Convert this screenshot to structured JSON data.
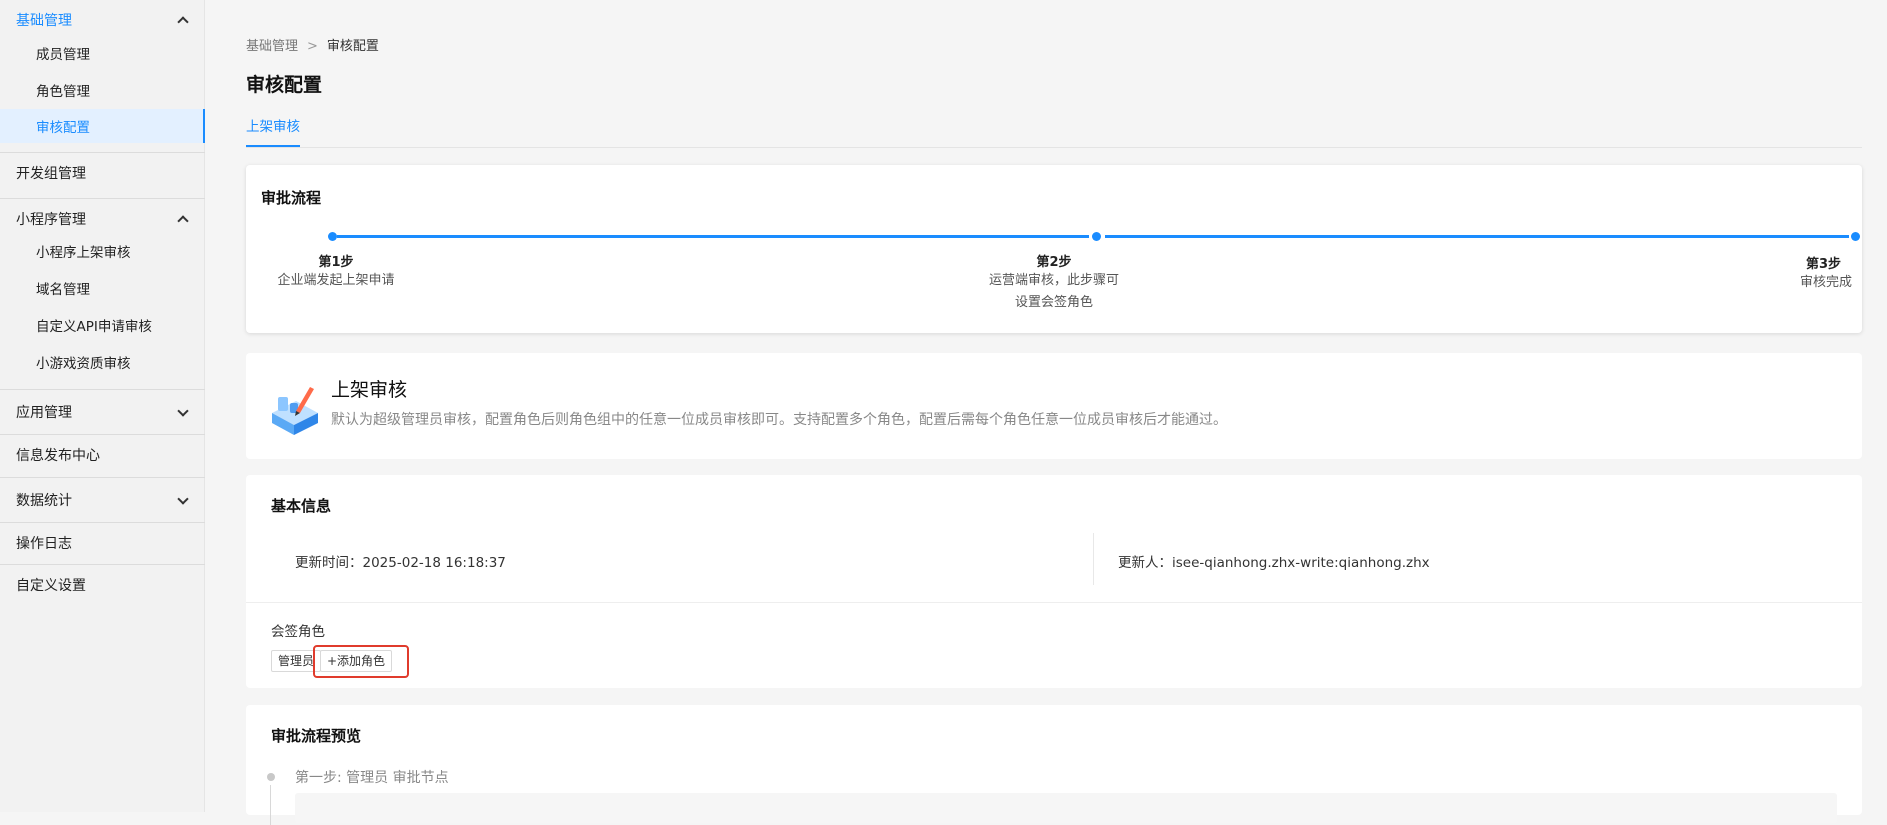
{
  "sidebar": {
    "groups": [
      {
        "label": "基础管理",
        "items": [
          "成员管理",
          "角色管理",
          "审核配置"
        ],
        "selected": "审核配置"
      },
      {
        "label": "开发组管理"
      },
      {
        "label": "小程序管理",
        "items": [
          "小程序上架审核",
          "域名管理",
          "自定义API申请审核",
          "小游戏资质审核"
        ]
      },
      {
        "label": "应用管理"
      },
      {
        "label": "信息发布中心"
      },
      {
        "label": "数据统计"
      },
      {
        "label": "操作日志"
      },
      {
        "label": "自定义设置"
      }
    ]
  },
  "breadcrumb": {
    "root": "基础管理",
    "separator": ">",
    "current": "审核配置"
  },
  "page": {
    "title": "审核配置",
    "tab": "上架审核"
  },
  "flow": {
    "title": "审批流程",
    "steps": [
      {
        "title": "第1步",
        "desc": [
          "企业端发起上架申请"
        ]
      },
      {
        "title": "第2步",
        "desc": [
          "运营端审核，此步骤可",
          "设置会签角色"
        ]
      },
      {
        "title": "第3步",
        "desc": [
          "审核完成"
        ]
      }
    ]
  },
  "intro": {
    "title": "上架审核",
    "desc": "默认为超级管理员审核，配置角色后则角色组中的任意一位成员审核即可。支持配置多个角色，配置后需每个角色任意一位成员审核后才能通过。"
  },
  "basic": {
    "title": "基本信息",
    "update_time_label": "更新时间：",
    "update_time": "2025-02-18 16:18:37",
    "updater_label": "更新人：",
    "updater": "isee-qianhong.zhx-write:qianhong.zhx",
    "sign_label": "会签角色",
    "role_tag": "管理员",
    "add_role": "+添加角色"
  },
  "preview": {
    "title": "审批流程预览",
    "step1": "第一步: 管理员 审批节点"
  },
  "colors": {
    "accent": "#1a8cff",
    "highlight": "#e03b2c"
  },
  "icons": [
    "chevron-up-icon",
    "chevron-down-icon",
    "audit-illustration-icon"
  ]
}
